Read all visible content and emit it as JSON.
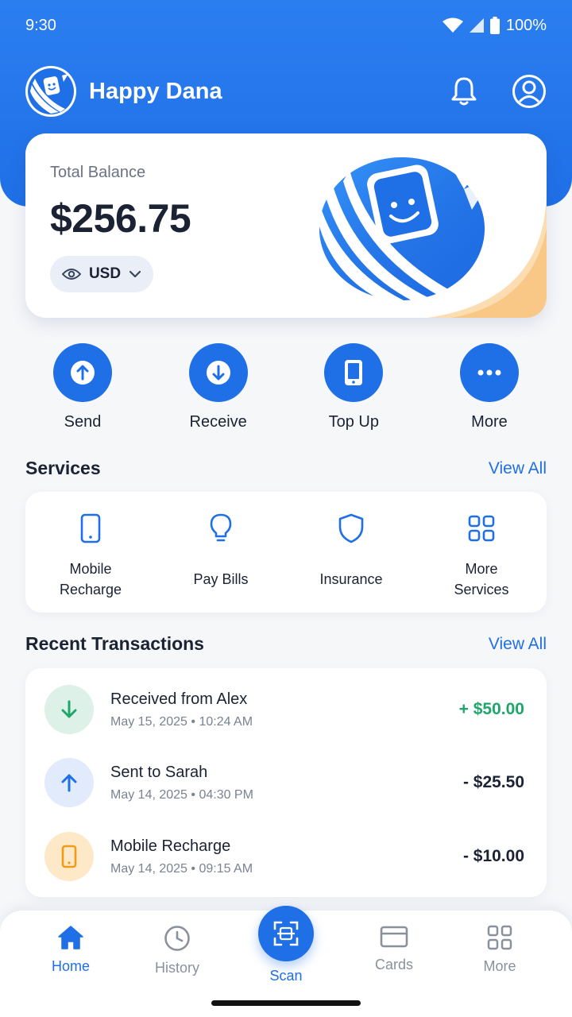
{
  "status_bar": {
    "time": "9:30",
    "battery": "100%"
  },
  "header": {
    "title": "Happy Dana",
    "icons": [
      "bell-icon",
      "account-icon"
    ]
  },
  "balance": {
    "label": "Total Balance",
    "amount": "$256.75",
    "currency": "USD"
  },
  "quick_actions": [
    {
      "label": "Send",
      "icon": "arrow-up-icon"
    },
    {
      "label": "Receive",
      "icon": "arrow-down-icon"
    },
    {
      "label": "Top Up",
      "icon": "phone-icon"
    },
    {
      "label": "More",
      "icon": "dots-icon"
    }
  ],
  "services": {
    "title": "Services",
    "view_all": "View All",
    "items": [
      {
        "label_line1": "Mobile",
        "label_line2": "Recharge",
        "icon": "phone-icon"
      },
      {
        "label_line1": "Pay Bills",
        "label_line2": "",
        "icon": "lightbulb-icon"
      },
      {
        "label_line1": "Insurance",
        "label_line2": "",
        "icon": "shield-icon"
      },
      {
        "label_line1": "More",
        "label_line2": "Services",
        "icon": "grid-icon"
      }
    ]
  },
  "transactions": {
    "title": "Recent Transactions",
    "view_all": "View All",
    "items": [
      {
        "title": "Received from Alex",
        "date": "May 15, 2025 • 10:24 AM",
        "amount": "+ $50.00",
        "type": "received"
      },
      {
        "title": "Sent to Sarah",
        "date": "May 14, 2025 • 04:30 PM",
        "amount": "- $25.50",
        "type": "sent"
      },
      {
        "title": "Mobile Recharge",
        "date": "May 14, 2025 • 09:15 AM",
        "amount": "- $10.00",
        "type": "recharge"
      }
    ]
  },
  "bottom_nav": {
    "items": [
      {
        "label": "Home",
        "icon": "home-icon",
        "active": true
      },
      {
        "label": "History",
        "icon": "clock-icon",
        "active": false
      },
      {
        "label": "Scan",
        "icon": "scan-icon",
        "active": false
      },
      {
        "label": "Cards",
        "icon": "card-icon",
        "active": false
      },
      {
        "label": "More",
        "icon": "grid-icon",
        "active": false
      }
    ]
  },
  "colors": {
    "primary": "#1f6fe6",
    "positive": "#1ea66b",
    "accent_orange": "#f6a623"
  }
}
